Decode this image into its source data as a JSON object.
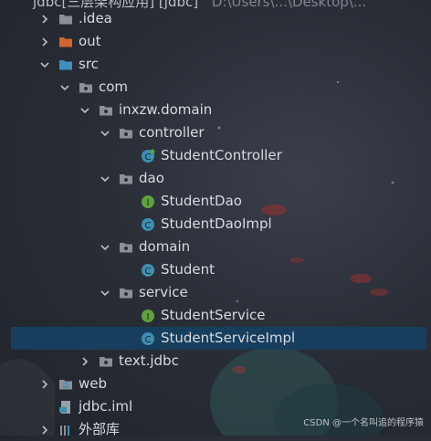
{
  "project_root": {
    "label": "jdbc[三层架构应用] [jdbc]",
    "path": "D:\\Users\\...\\Desktop\\..."
  },
  "tree": {
    "idea": {
      "label": ".idea"
    },
    "out": {
      "label": "out"
    },
    "src": {
      "label": "src"
    },
    "com": {
      "label": "com"
    },
    "inxzw_domain": {
      "label": "inxzw.domain"
    },
    "controller": {
      "label": "controller"
    },
    "student_controller": {
      "label": "StudentController"
    },
    "dao": {
      "label": "dao"
    },
    "student_dao": {
      "label": "StudentDao"
    },
    "student_dao_impl": {
      "label": "StudentDaoImpl"
    },
    "domain": {
      "label": "domain"
    },
    "student": {
      "label": "Student"
    },
    "service": {
      "label": "service"
    },
    "student_service": {
      "label": "StudentService"
    },
    "student_service_impl": {
      "label": "StudentServiceImpl"
    },
    "text_jdbc": {
      "label": "text.jdbc"
    },
    "web": {
      "label": "web"
    },
    "jdbc_iml": {
      "label": "jdbc.iml"
    },
    "external_libs": {
      "label": "外部库"
    }
  },
  "watermark": "CSDN @一个名叫追的程序猿",
  "colors": {
    "selection": "#173f61",
    "folder": "#8c9096",
    "folder_excluded": "#d0662f",
    "source_root": "#3f8fbf",
    "class_icon": "#3e8fb0",
    "interface_icon": "#5fa13d"
  }
}
